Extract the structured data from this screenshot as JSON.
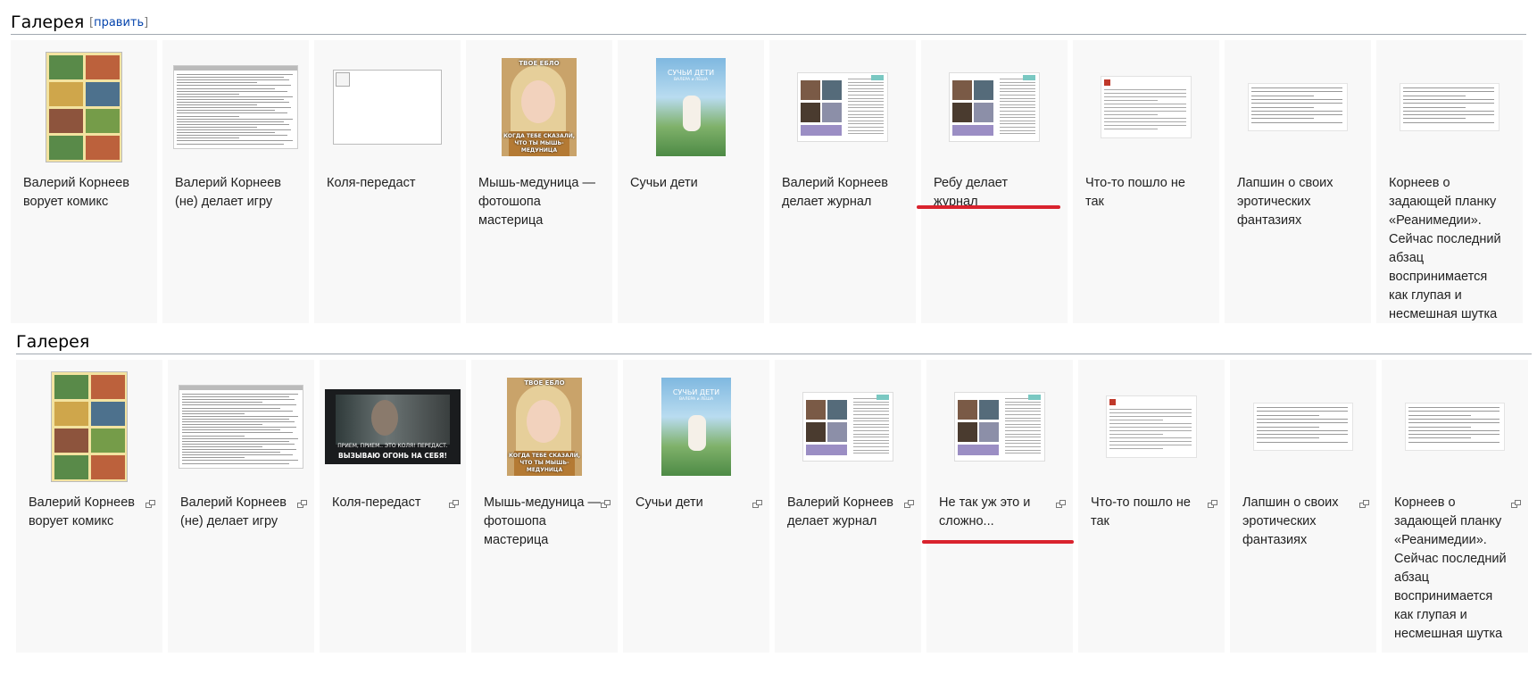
{
  "galleries": [
    {
      "title": "Галерея",
      "edit_open": "[",
      "edit_link": "править",
      "edit_close": "]",
      "items": [
        {
          "caption": "Валерий Корнеев ворует комикс",
          "thumb": "comic"
        },
        {
          "caption": "Валерий Корнеев (не) делает игру",
          "thumb": "document"
        },
        {
          "caption": "Коля-передаст",
          "thumb": "broken-image"
        },
        {
          "caption": "Мышь-медуница — фотошопа мастерица",
          "thumb": "meme",
          "meme_top": "ТВОЕ ЕБЛО",
          "meme_bottom": "КОГДА ТЕБЕ СКАЗАЛИ, ЧТО ТЫ МЫШЬ-МЕДУНИЦА"
        },
        {
          "caption": "Сучьи дети",
          "thumb": "poster",
          "poster_title": "СУЧЬИ ДЕТИ",
          "poster_subtitle": "ВАЛЕРА и ЛЕША"
        },
        {
          "caption": "Валерий Корнеев делает журнал",
          "thumb": "magazine"
        },
        {
          "caption": "Ребу делает журнал",
          "thumb": "magazine"
        },
        {
          "caption": "Что-то пошло не так",
          "thumb": "tweet"
        },
        {
          "caption": "Лапшин о своих эротических фантазиях",
          "thumb": "text"
        },
        {
          "caption": "Корнеев о задающей планку «Реанимедии». Сейчас последний абзац воспринимается как глупая и несмешная шутка",
          "thumb": "text"
        }
      ]
    },
    {
      "title": "Галерея",
      "items": [
        {
          "caption": "Валерий Корнеев ворует комикс",
          "thumb": "comic"
        },
        {
          "caption": "Валерий Корнеев (не) делает игру",
          "thumb": "document"
        },
        {
          "caption": "Коля-передаст",
          "thumb": "video-still",
          "video_line1": "ПРИЕМ, ПРИЕМ.. ЭТО КОЛЯ! ПЕРЕДАСТ.",
          "video_line2": "ВЫЗЫВАЮ ОГОНЬ НА СЕБЯ!"
        },
        {
          "caption": "Мышь-медуница — фотошопа мастерица",
          "thumb": "meme",
          "meme_top": "ТВОЕ ЕБЛО",
          "meme_bottom": "КОГДА ТЕБЕ СКАЗАЛИ, ЧТО ТЫ МЫШЬ-МЕДУНИЦА"
        },
        {
          "caption": "Сучьи дети",
          "thumb": "poster",
          "poster_title": "СУЧЬИ ДЕТИ",
          "poster_subtitle": "ВАЛЕРА и ЛЕША"
        },
        {
          "caption": "Валерий Корнеев делает журнал",
          "thumb": "magazine"
        },
        {
          "caption": "Не так уж это и сложно...",
          "thumb": "magazine"
        },
        {
          "caption": "Что-то пошло не так",
          "thumb": "tweet"
        },
        {
          "caption": "Лапшин о своих эротических фантазиях",
          "thumb": "text"
        },
        {
          "caption": "Корнеев о задающей планку «Реанимедии». Сейчас последний абзац воспринимается как глупая и несмешная шутка",
          "thumb": "text"
        }
      ]
    }
  ],
  "highlight_color": "#d9232e",
  "link_color": "#0645ad"
}
